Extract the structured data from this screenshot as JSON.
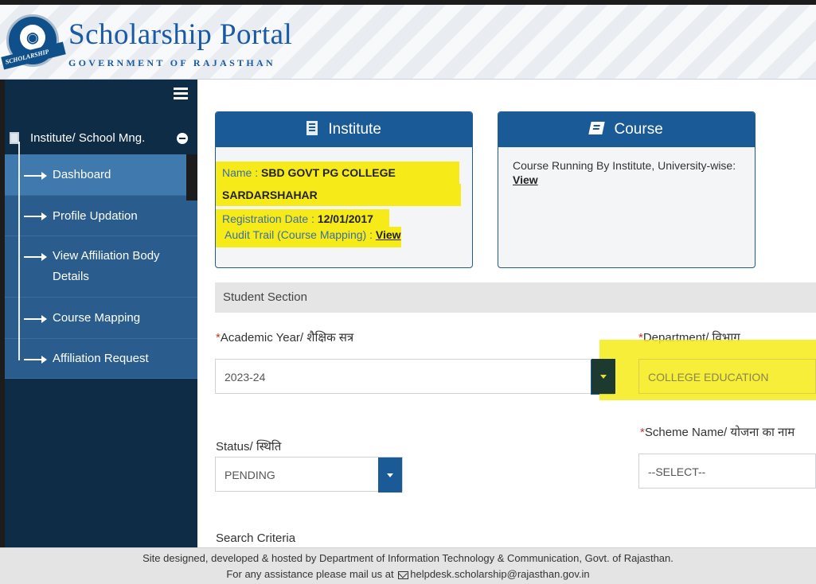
{
  "header": {
    "title": "Scholarship Portal",
    "subtitle": "GOVERNMENT OF RAJASTHAN",
    "logo_ribbon": "SCHOLARSHIP"
  },
  "sidebar": {
    "group_label": "Institute/ School Mng.",
    "items": [
      {
        "label": "Dashboard",
        "active": true
      },
      {
        "label": "Profile Updation",
        "active": false
      },
      {
        "label": "View Affiliation Body Details",
        "active": false
      },
      {
        "label": "Course Mapping",
        "active": false
      },
      {
        "label": "Affiliation Request",
        "active": false
      }
    ]
  },
  "institute_card": {
    "title": "Institute",
    "name_label": "Name : ",
    "name_value_1": "SBD GOVT PG COLLEGE",
    "name_value_2": "SARDARSHAHAR",
    "reg_label": "Registration Date : ",
    "reg_value": "12/01/2017",
    "audit_label": "Audit Trail (Course Mapping) : ",
    "audit_link": "View"
  },
  "course_card": {
    "title": "Course",
    "text": "Course Running By Institute, University-wise:",
    "link": "View"
  },
  "student_section": {
    "title": "Student Section",
    "academic_year_label": "Academic Year/ शैक्षिक सत्र",
    "academic_year_value": "2023-24",
    "department_label": "Department/ विभाग",
    "department_value": "COLLEGE EDUCATION",
    "status_label": "Status/ स्थिति",
    "status_value": "PENDING",
    "scheme_label": "Scheme Name/ योजना का नाम",
    "scheme_value": "--SELECT--",
    "search_criteria_label": "Search Criteria"
  },
  "footer": {
    "line1": "Site designed, developed & hosted by Department of Information Technology & Communication, Govt. of Rajasthan.",
    "line2_prefix": "For any assistance please mail us at",
    "email": "helpdesk.scholarship@rajasthan.gov.in"
  },
  "colors": {
    "sidebar_bg": "#0f2c46",
    "menu_bg": "#2a5d8e",
    "accent_blue": "#1a5a97",
    "highlight": "#f6eb18"
  }
}
